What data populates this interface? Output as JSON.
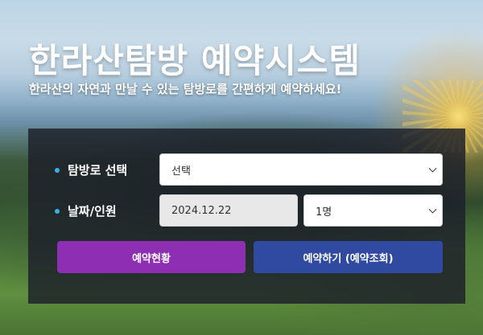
{
  "header": {
    "title": "한라산탐방 예약시스템",
    "subtitle": "한라산의 자연과 만날 수 있는 탐방로를 간편하게 예약하세요!"
  },
  "form": {
    "trail": {
      "label": "탐방로 선택",
      "value": "선택"
    },
    "date": {
      "label": "날짜/인원",
      "value": "2024.12.22"
    },
    "people": {
      "value": "1명"
    }
  },
  "buttons": {
    "status": "예약현황",
    "reserve": "예약하기 (예약조회)"
  },
  "colors": {
    "status_button": "#8e2fb3",
    "reserve_button": "#2f4aa0",
    "bullet": "#3ab0e8",
    "panel": "#1c1e2a"
  },
  "icons": [
    "chevron-down-icon",
    "bullet-icon"
  ]
}
